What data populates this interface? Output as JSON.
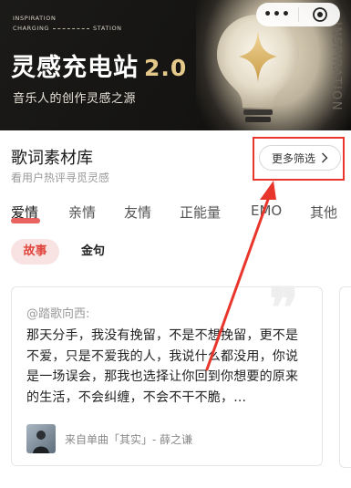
{
  "banner": {
    "tag_line1": "INSPIRATION",
    "tag_line2_left": "CHARGING",
    "tag_line2_right": "STATION",
    "title": "灵感充电站",
    "version": "2.0",
    "subtitle": "音乐人的创作灵感之源",
    "vertical": "INSPIRATION"
  },
  "capsule": {
    "more_label": "•••",
    "close_icon": "target-circle-icon"
  },
  "section": {
    "title": "歌词素材库",
    "subtitle": "看用户热评寻觅灵感",
    "filter_label": "更多筛选",
    "filter_icon": "chevron-right-icon"
  },
  "tabs": [
    "爱情",
    "亲情",
    "友情",
    "正能量",
    "EMO",
    "其他"
  ],
  "active_tab": "爱情",
  "pills": {
    "active": "故事",
    "other": "金句"
  },
  "card": {
    "author": "@踏歌向西:",
    "text": "那天分手，我没有挽留，不是不想挽留，更不是不爱，只是不爱我的人，我说什么都没用，你说是一场误会，那我也选择让你回到你想要的原来的生活，不会纠缠，不会不干不脆，...",
    "source": "来自单曲「其实」- 薛之谦"
  },
  "colors": {
    "accent_red": "#e0453e",
    "annotation_red": "#e8362c",
    "banner_gold": "#e5c98b"
  }
}
